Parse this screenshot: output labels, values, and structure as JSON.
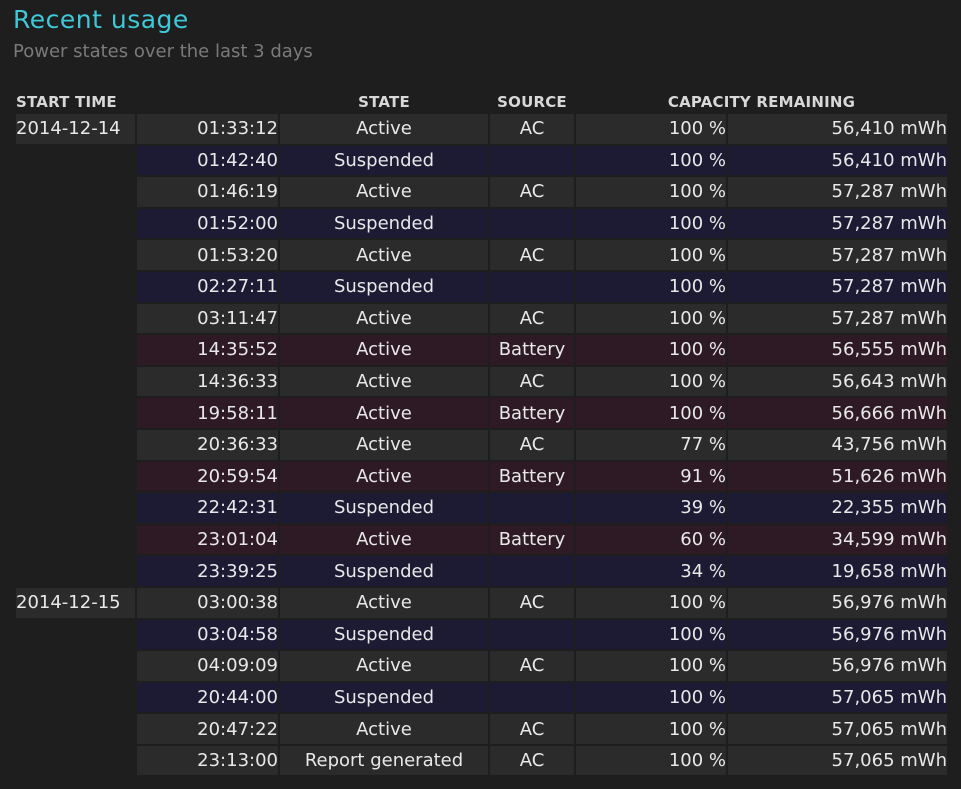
{
  "header": {
    "title": "Recent usage",
    "subtitle": "Power states over the last 3 days"
  },
  "table": {
    "columns": {
      "start_time": "START TIME",
      "state": "STATE",
      "source": "SOURCE",
      "capacity": "CAPACITY REMAINING"
    },
    "rows": [
      {
        "kind": "ac",
        "date": "2014-12-14",
        "time": "01:33:12",
        "state": "Active",
        "source": "AC",
        "percent": "100 %",
        "energy": "56,410 mWh"
      },
      {
        "kind": "suspended",
        "date": "",
        "time": "01:42:40",
        "state": "Suspended",
        "source": "",
        "percent": "100 %",
        "energy": "56,410 mWh"
      },
      {
        "kind": "ac",
        "date": "",
        "time": "01:46:19",
        "state": "Active",
        "source": "AC",
        "percent": "100 %",
        "energy": "57,287 mWh"
      },
      {
        "kind": "suspended",
        "date": "",
        "time": "01:52:00",
        "state": "Suspended",
        "source": "",
        "percent": "100 %",
        "energy": "57,287 mWh"
      },
      {
        "kind": "ac",
        "date": "",
        "time": "01:53:20",
        "state": "Active",
        "source": "AC",
        "percent": "100 %",
        "energy": "57,287 mWh"
      },
      {
        "kind": "suspended",
        "date": "",
        "time": "02:27:11",
        "state": "Suspended",
        "source": "",
        "percent": "100 %",
        "energy": "57,287 mWh"
      },
      {
        "kind": "ac",
        "date": "",
        "time": "03:11:47",
        "state": "Active",
        "source": "AC",
        "percent": "100 %",
        "energy": "57,287 mWh"
      },
      {
        "kind": "battery",
        "date": "",
        "time": "14:35:52",
        "state": "Active",
        "source": "Battery",
        "percent": "100 %",
        "energy": "56,555 mWh"
      },
      {
        "kind": "ac",
        "date": "",
        "time": "14:36:33",
        "state": "Active",
        "source": "AC",
        "percent": "100 %",
        "energy": "56,643 mWh"
      },
      {
        "kind": "battery",
        "date": "",
        "time": "19:58:11",
        "state": "Active",
        "source": "Battery",
        "percent": "100 %",
        "energy": "56,666 mWh"
      },
      {
        "kind": "ac",
        "date": "",
        "time": "20:36:33",
        "state": "Active",
        "source": "AC",
        "percent": "77 %",
        "energy": "43,756 mWh"
      },
      {
        "kind": "battery",
        "date": "",
        "time": "20:59:54",
        "state": "Active",
        "source": "Battery",
        "percent": "91 %",
        "energy": "51,626 mWh"
      },
      {
        "kind": "suspended",
        "date": "",
        "time": "22:42:31",
        "state": "Suspended",
        "source": "",
        "percent": "39 %",
        "energy": "22,355 mWh"
      },
      {
        "kind": "battery",
        "date": "",
        "time": "23:01:04",
        "state": "Active",
        "source": "Battery",
        "percent": "60 %",
        "energy": "34,599 mWh"
      },
      {
        "kind": "suspended",
        "date": "",
        "time": "23:39:25",
        "state": "Suspended",
        "source": "",
        "percent": "34 %",
        "energy": "19,658 mWh"
      },
      {
        "kind": "ac",
        "date": "2014-12-15",
        "time": "03:00:38",
        "state": "Active",
        "source": "AC",
        "percent": "100 %",
        "energy": "56,976 mWh"
      },
      {
        "kind": "suspended",
        "date": "",
        "time": "03:04:58",
        "state": "Suspended",
        "source": "",
        "percent": "100 %",
        "energy": "56,976 mWh"
      },
      {
        "kind": "ac",
        "date": "",
        "time": "04:09:09",
        "state": "Active",
        "source": "AC",
        "percent": "100 %",
        "energy": "56,976 mWh"
      },
      {
        "kind": "suspended",
        "date": "",
        "time": "20:44:00",
        "state": "Suspended",
        "source": "",
        "percent": "100 %",
        "energy": "57,065 mWh"
      },
      {
        "kind": "ac",
        "date": "",
        "time": "20:47:22",
        "state": "Active",
        "source": "AC",
        "percent": "100 %",
        "energy": "57,065 mWh"
      },
      {
        "kind": "report",
        "date": "",
        "time": "23:13:00",
        "state": "Report generated",
        "source": "AC",
        "percent": "100 %",
        "energy": "57,065 mWh"
      }
    ]
  },
  "colors": {
    "title": "#3ec8d8",
    "ac_row": "#2b2b2b",
    "suspended_row": "#1c1b33",
    "battery_row": "#2e1a24"
  }
}
